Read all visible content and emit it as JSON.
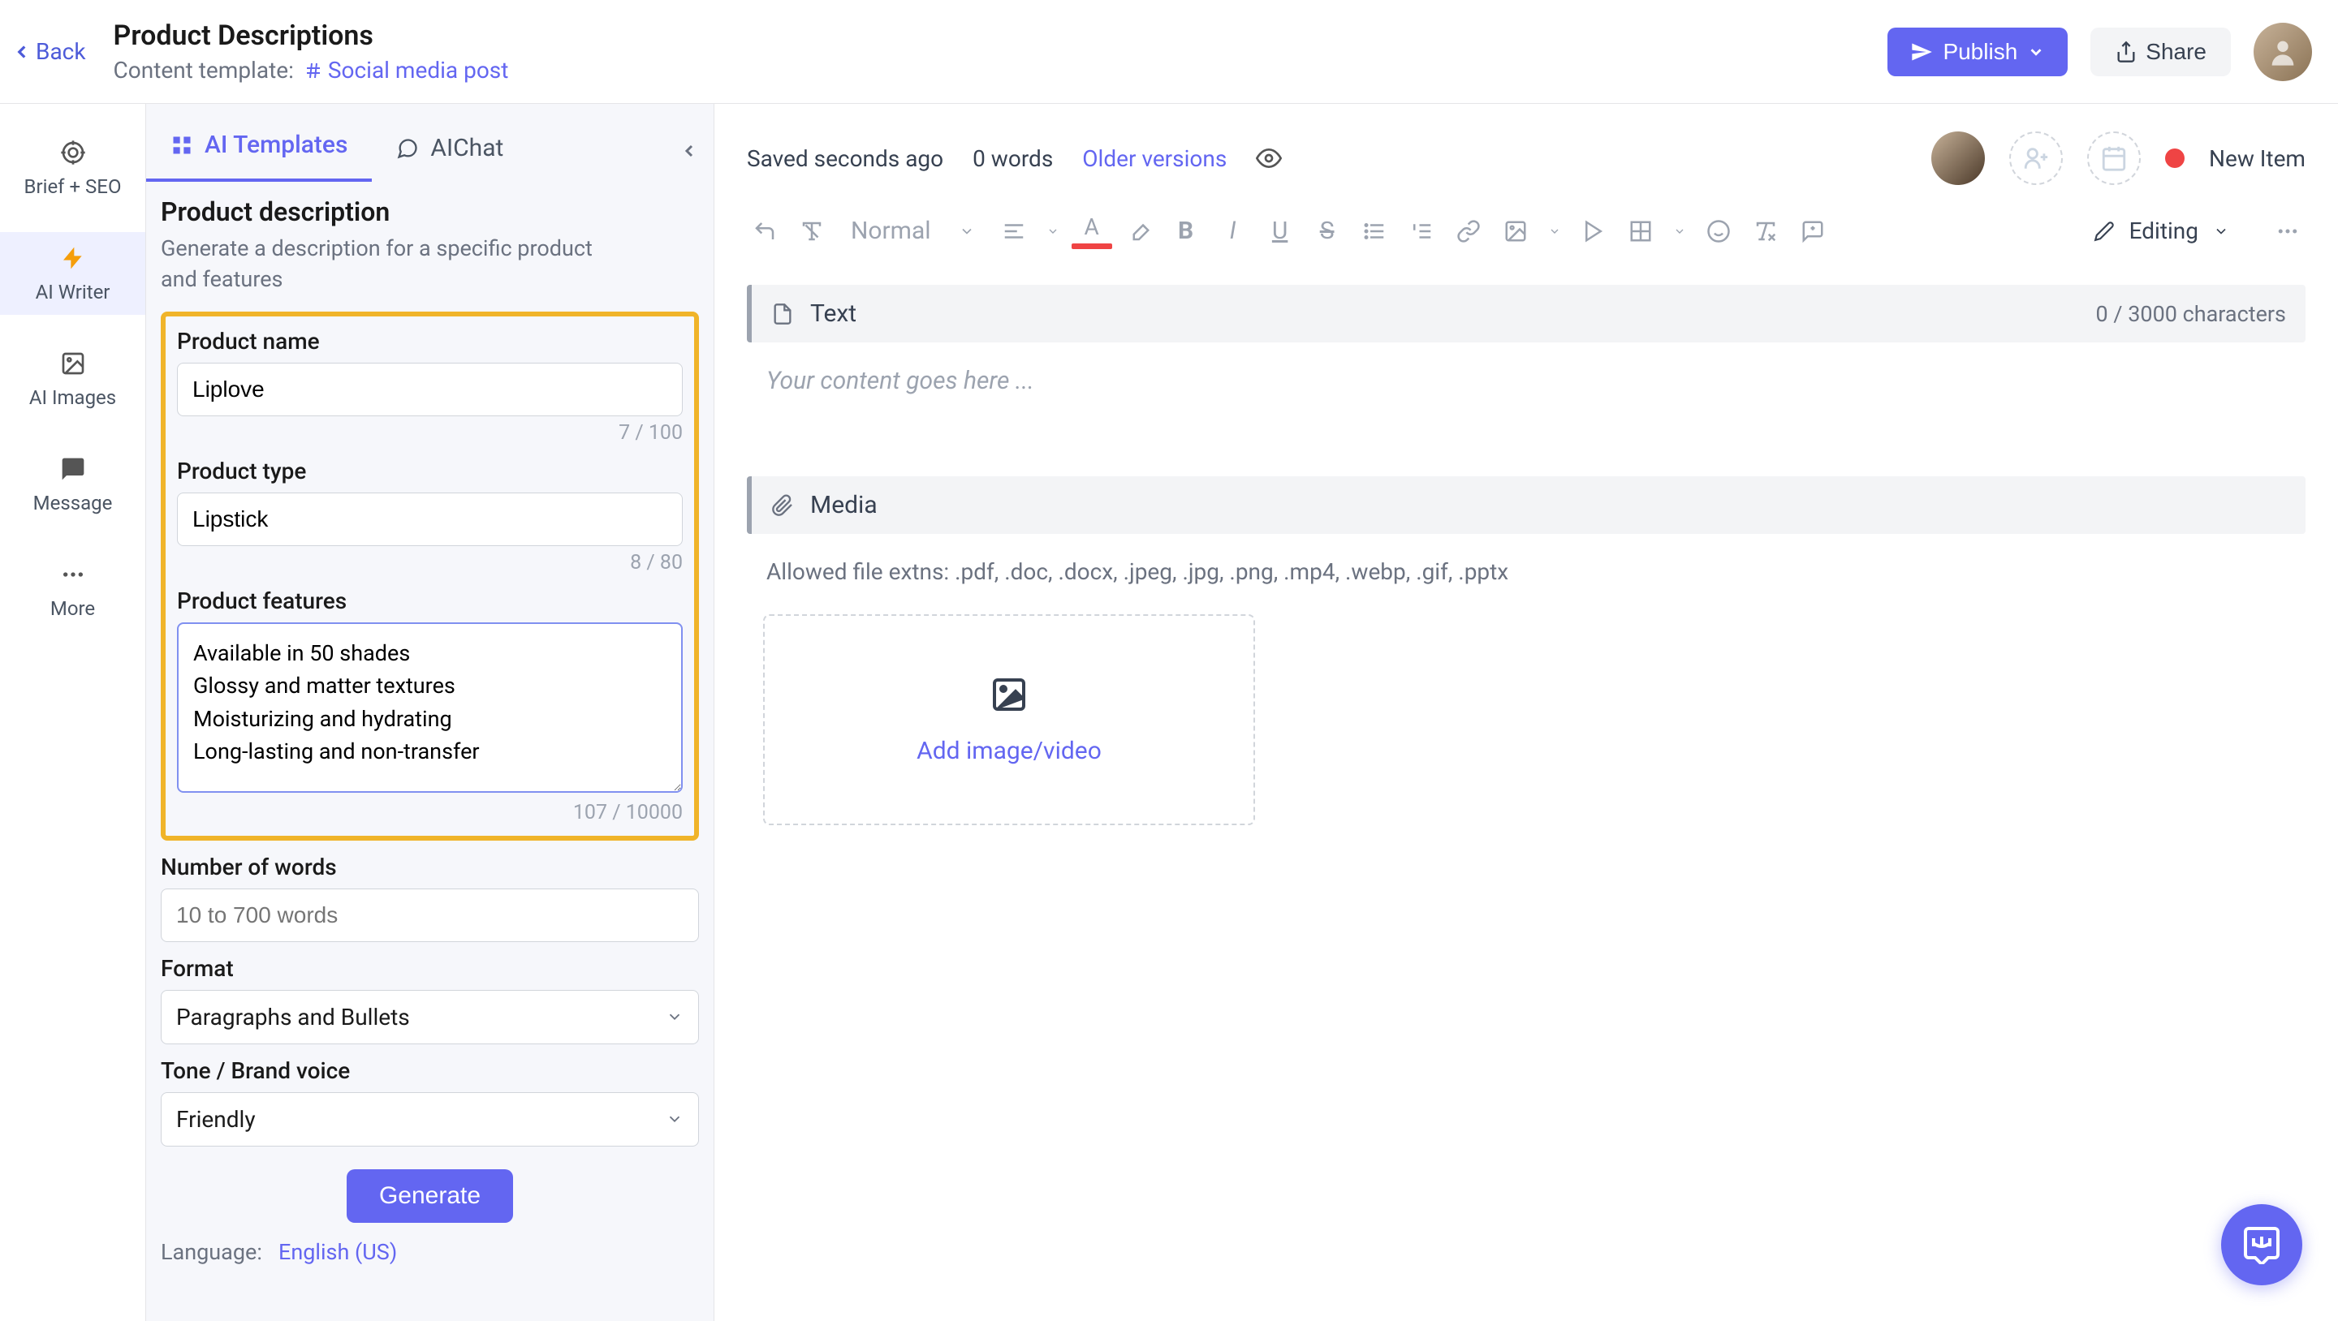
{
  "header": {
    "back_label": "Back",
    "title": "Product Descriptions",
    "content_template_prefix": "Content template:",
    "content_template_name": "Social media post",
    "publish_label": "Publish",
    "share_label": "Share"
  },
  "sidenav": {
    "items": [
      {
        "label": "Brief + SEO",
        "icon": "target-icon"
      },
      {
        "label": "AI Writer",
        "icon": "bolt-icon"
      },
      {
        "label": "AI Images",
        "icon": "image-icon"
      },
      {
        "label": "Message",
        "icon": "chat-icon"
      },
      {
        "label": "More",
        "icon": "dots-icon"
      }
    ],
    "active_index": 1
  },
  "tabs": {
    "templates_label": "AI Templates",
    "chat_label": "AIChat"
  },
  "panel": {
    "heading": "Product description",
    "subtitle": "Generate a description for a specific product and features",
    "product_name_label": "Product name",
    "product_name_value": "Liplove",
    "product_name_counter": "7 / 100",
    "product_type_label": "Product type",
    "product_type_value": "Lipstick",
    "product_type_counter": "8 / 80",
    "features_label": "Product features",
    "features_value": "Available in 50 shades\nGlossy and matter textures\nMoisturizing and hydrating\nLong-lasting and non-transfer",
    "features_counter": "107 / 10000",
    "words_label": "Number of words",
    "words_placeholder": "10 to 700 words",
    "format_label": "Format",
    "format_value": "Paragraphs and Bullets",
    "tone_label": "Tone / Brand voice",
    "tone_value": "Friendly",
    "generate_label": "Generate",
    "language_prefix": "Language:",
    "language_value": "English (US)"
  },
  "editor": {
    "saved_text": "Saved seconds ago",
    "word_count": "0 words",
    "older_versions": "Older versions",
    "new_item": "New Item",
    "normal_label": "Normal",
    "editing_label": "Editing",
    "text_block_title": "Text",
    "text_char_counter": "0 / 3000 characters",
    "text_placeholder": "Your content goes here ...",
    "media_block_title": "Media",
    "allowed_extns": "Allowed file extns: .pdf, .doc, .docx, .jpeg, .jpg, .png, .mp4, .webp, .gif, .pptx",
    "add_media_label": "Add image/video"
  }
}
